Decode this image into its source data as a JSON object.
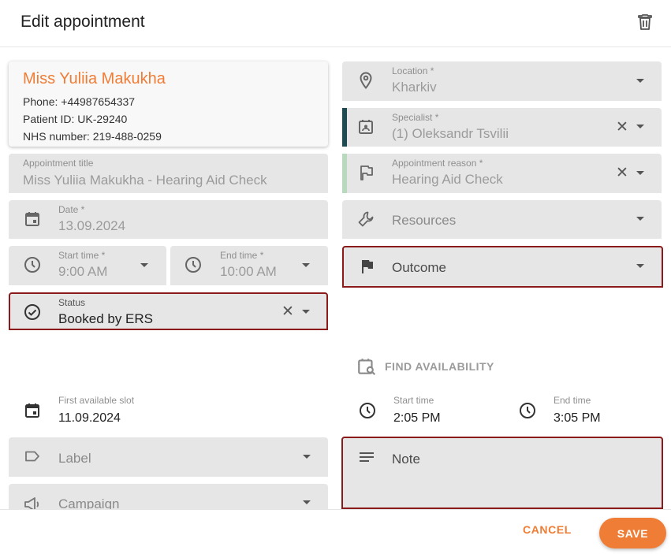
{
  "dialog": {
    "title": "Edit appointment"
  },
  "patient": {
    "name": "Miss Yuliia Makukha",
    "phone": "Phone: +44987654337",
    "patient_id": "Patient ID: UK-29240",
    "nhs": "NHS number: 219-488-0259"
  },
  "appointment_title": {
    "label": "Appointment title",
    "value": "Miss Yuliia Makukha - Hearing Aid Check"
  },
  "date": {
    "label": "Date *",
    "value": "13.09.2024"
  },
  "start_time": {
    "label": "Start time *",
    "value": "9:00 AM"
  },
  "end_time": {
    "label": "End time *",
    "value": "10:00 AM"
  },
  "status": {
    "label": "Status",
    "value": "Booked by ERS"
  },
  "location": {
    "label": "Location *",
    "value": "Kharkiv"
  },
  "specialist": {
    "label": "Specialist *",
    "value": "(1) Oleksandr Tsvilii",
    "accent": "#1f4a52"
  },
  "appointment_reason": {
    "label": "Appointment reason *",
    "value": "Hearing Aid Check",
    "accent": "#b9d9bf"
  },
  "resources": {
    "placeholder": "Resources"
  },
  "outcome": {
    "placeholder": "Outcome"
  },
  "find_availability": {
    "label": "FIND AVAILABILITY"
  },
  "first_available_slot": {
    "label": "First available slot",
    "value": "11.09.2024"
  },
  "slot_start": {
    "label": "Start time",
    "value": "2:05 PM"
  },
  "slot_end": {
    "label": "End time",
    "value": "3:05 PM"
  },
  "label_field": {
    "placeholder": "Label"
  },
  "campaign": {
    "placeholder": "Campaign"
  },
  "note": {
    "placeholder": "Note"
  },
  "footer": {
    "cancel": "CANCEL",
    "save": "SAVE"
  },
  "colors": {
    "brand": "#ef7d35",
    "error_outline": "#8b1a1a"
  }
}
